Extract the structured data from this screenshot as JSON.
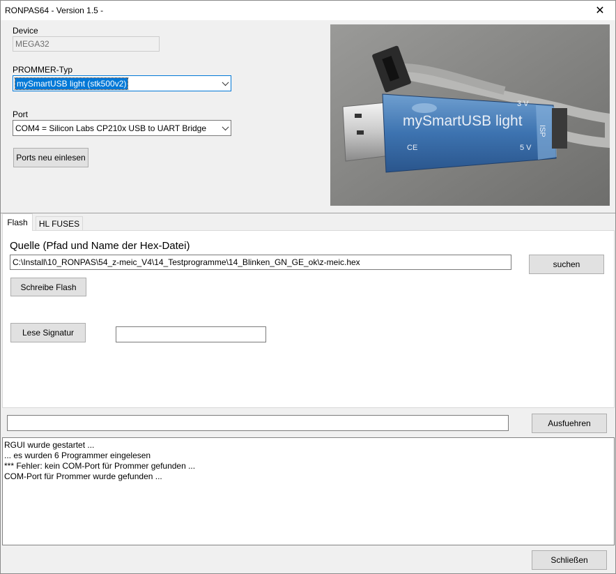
{
  "window": {
    "title": "RONPAS64 - Version 1.5 -",
    "close_glyph": "✕"
  },
  "device": {
    "label": "Device",
    "value": "MEGA32"
  },
  "prommer": {
    "label": "PROMMER-Typ",
    "value": "mySmartUSB light (stk500v2)"
  },
  "port": {
    "label": "Port",
    "value": "COM4 = Silicon Labs CP210x USB to UART Bridge"
  },
  "rescan_button": "Ports neu einlesen",
  "photo": {
    "brand_text": "mySmartUSB light",
    "label_3v": "3 V",
    "label_5v": "5 V",
    "label_isp": "ISP",
    "label_ce": "CE"
  },
  "tabs": [
    {
      "label": "Flash"
    },
    {
      "label": "HL FUSES"
    }
  ],
  "flash": {
    "source_label": "Quelle (Pfad und Name der Hex-Datei)",
    "source_path": "C:\\Install\\10_RONPAS\\54_z-meic_V4\\14_Testprogramme\\14_Blinken_GN_GE_ok\\z-meic.hex",
    "browse_button": "suchen",
    "write_button": "Schreibe Flash",
    "signature_button": "Lese Signatur",
    "signature_value": ""
  },
  "command": {
    "value": "",
    "run_button": "Ausfuehren"
  },
  "log": [
    "RGUI wurde gestartet ...",
    "... es wurden 6 Programmer eingelesen",
    "*** Fehler: kein COM-Port für Prommer gefunden ...",
    "COM-Port für Prommer wurde gefunden ..."
  ],
  "close_button": "Schließen"
}
